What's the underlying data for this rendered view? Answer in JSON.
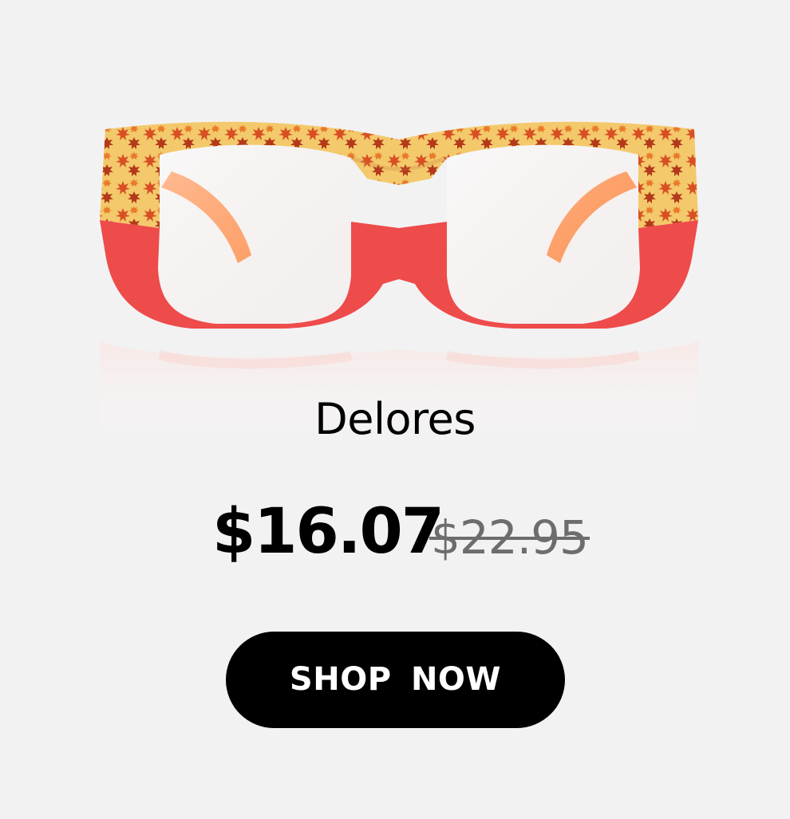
{
  "product": {
    "name": "Delores",
    "sale_price": "$16.07",
    "original_price": "$22.95"
  },
  "actions": {
    "shop_now_label": "SHOP  NOW"
  },
  "colors": {
    "background": "#f3f2f2",
    "text_primary": "#000000",
    "text_strikethrough": "#6d6d6d",
    "button_background": "#000000",
    "button_text": "#ffffff",
    "frame_top": "#f3c96b",
    "frame_leaf_pattern": "#df5b36",
    "frame_bottom": "#ee4b4b",
    "temple_color": "#ff7d2f"
  }
}
